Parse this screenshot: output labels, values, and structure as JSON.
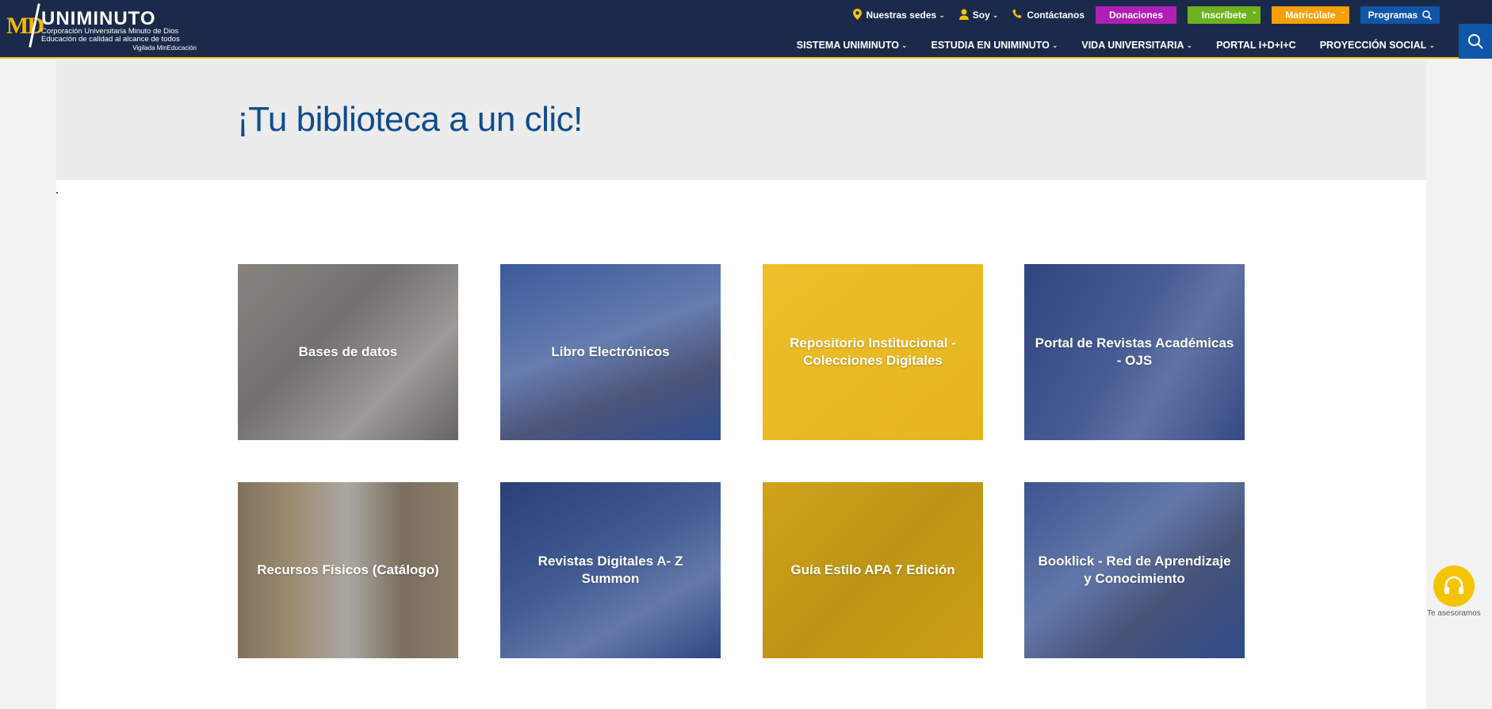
{
  "logo": {
    "md": "MD",
    "name": "UNIMINUTO",
    "line1": "Corporación Universitaria Minuto de Dios",
    "line2": "Educación de calidad al alcance de todos",
    "line3": "Vigilada MinEducación"
  },
  "topbar": {
    "links": [
      {
        "label": "Nuestras sedes",
        "icon": "location-pin-icon"
      },
      {
        "label": "Soy",
        "icon": "person-icon"
      },
      {
        "label": "Contáctanos",
        "icon": "phone-icon"
      }
    ],
    "buttons": {
      "donaciones": "Donaciones",
      "inscribete": "Inscríbete",
      "matriculate": "Matricúlate",
      "programas": "Programas"
    }
  },
  "mainnav": [
    {
      "label": "SISTEMA UNIMINUTO"
    },
    {
      "label": "ESTUDIA EN UNIMINUTO"
    },
    {
      "label": "VIDA UNIVERSITARIA"
    },
    {
      "label": "PORTAL I+D+I+C"
    },
    {
      "label": "PROYECCIÓN SOCIAL"
    }
  ],
  "hero": {
    "title": "¡Tu biblioteca a un clic!"
  },
  "cards": [
    {
      "label": "Bases de datos",
      "overlay": "gray"
    },
    {
      "label": "Libro Electrónicos",
      "overlay": "blue"
    },
    {
      "label": "Repositorio Institucional - Colecciones Digitales",
      "overlay": "yellow"
    },
    {
      "label": "Portal de Revistas Académicas - OJS",
      "overlay": "blue"
    },
    {
      "label": "Recursos Físicos (Catálogo)",
      "overlay": "gray"
    },
    {
      "label": "Revistas Digitales A- Z Summon",
      "overlay": "blue"
    },
    {
      "label": "Guía Estilo APA 7 Edición",
      "overlay": "darkyellow"
    },
    {
      "label": "Booklick - Red de Aprendizaje y Conocimiento",
      "overlay": "blue"
    }
  ],
  "assist": {
    "label": "Te asesoramos",
    "icon": "headset-icon"
  },
  "colors": {
    "header_bg": "#1b2a4a",
    "accent_yellow": "#f5c400",
    "title_blue": "#0f4c8c",
    "donaciones": "#b01fb5",
    "inscribete": "#6fb21f",
    "matriculate": "#f5a000",
    "programas": "#0f55a8"
  }
}
